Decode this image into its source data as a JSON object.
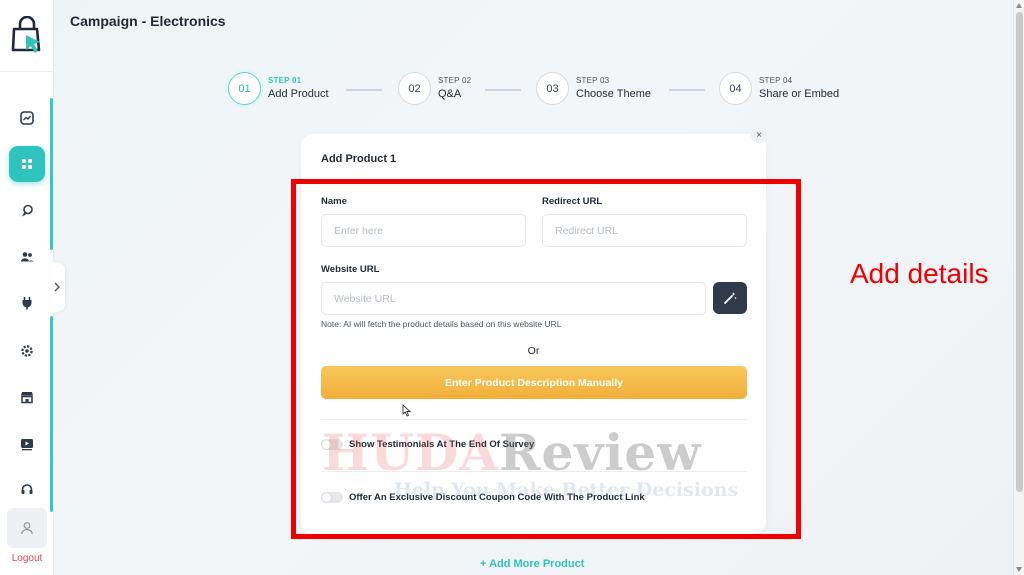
{
  "header": {
    "title": "Campaign - Electronics"
  },
  "sidebar": {
    "items": [
      {
        "icon": "analytics-icon"
      },
      {
        "icon": "dashboard-grid-icon",
        "active": true
      },
      {
        "icon": "paint-icon"
      },
      {
        "icon": "users-icon"
      },
      {
        "icon": "plug-icon"
      },
      {
        "icon": "settings-icon"
      },
      {
        "icon": "store-icon"
      },
      {
        "icon": "video-icon"
      },
      {
        "icon": "support-icon"
      }
    ],
    "logout_label": "Logout"
  },
  "stepper": {
    "steps": [
      {
        "step_label": "STEP 01",
        "number": "01",
        "name": "Add Product",
        "active": true
      },
      {
        "step_label": "STEP 02",
        "number": "02",
        "name": "Q&A"
      },
      {
        "step_label": "STEP 03",
        "number": "03",
        "name": "Choose Theme"
      },
      {
        "step_label": "STEP 04",
        "number": "04",
        "name": "Share or Embed"
      }
    ]
  },
  "form": {
    "title": "Add Product 1",
    "close_label": "×",
    "name_label": "Name",
    "name_placeholder": "Enter here",
    "redirect_label": "Redirect URL",
    "redirect_placeholder": "Redirect URL",
    "website_label": "Website URL",
    "website_placeholder": "Website URL",
    "note": "Note: AI will fetch the product details based on this website URL",
    "or_text": "Or",
    "manual_button": "Enter Product Description Manually",
    "toggle_testimonials": "Show Testimonials At The End Of Survey",
    "toggle_discount": "Offer An Exclusive Discount Coupon Code With The Product Link"
  },
  "add_more": "+ Add More Product",
  "annotation": {
    "text": "Add details",
    "color": "#f00000"
  },
  "watermark": {
    "title_a": "HUDA",
    "title_b": "Review",
    "subtitle": "Help You Make Better Decisions"
  },
  "colors": {
    "accent": "#2ec4bd",
    "button": "#f2ae3a",
    "dark_button": "#2f3b4a"
  }
}
